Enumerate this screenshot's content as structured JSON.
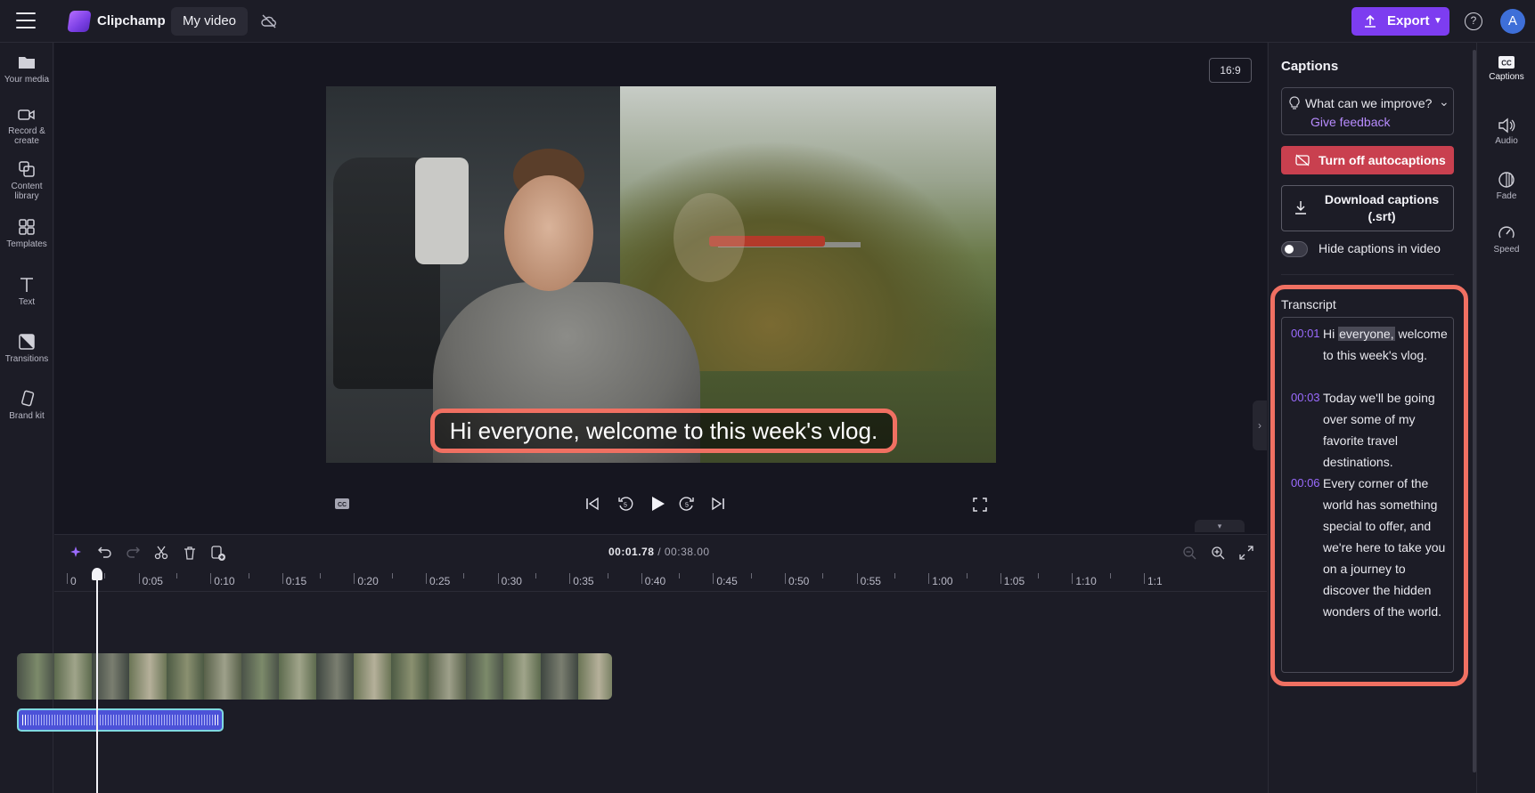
{
  "topbar": {
    "brand": "Clipchamp",
    "project_title": "My video",
    "export_label": "Export",
    "avatar_initial": "A"
  },
  "leftnav": {
    "items": [
      {
        "label": "Your media",
        "icon": "folder-icon"
      },
      {
        "label": "Record & create",
        "icon": "camera-icon"
      },
      {
        "label": "Content library",
        "icon": "library-icon"
      },
      {
        "label": "Templates",
        "icon": "templates-icon"
      },
      {
        "label": "Text",
        "icon": "text-icon"
      },
      {
        "label": "Transitions",
        "icon": "transitions-icon"
      },
      {
        "label": "Brand kit",
        "icon": "brand-kit-icon"
      }
    ]
  },
  "preview": {
    "aspect_ratio": "16:9",
    "caption": "Hi everyone, welcome to this week's vlog."
  },
  "timeline": {
    "current_time": "00:01.78",
    "total_time": "/ 00:38.00",
    "ruler_labels": [
      "0",
      "0:05",
      "0:10",
      "0:15",
      "0:20",
      "0:25",
      "0:30",
      "0:35",
      "0:40",
      "0:45",
      "0:50",
      "0:55",
      "1:00",
      "1:05",
      "1:10",
      "1:1"
    ],
    "playhead_fraction": 0.047
  },
  "captions_panel": {
    "title": "Captions",
    "feedback_question": "What can we improve?",
    "feedback_link": "Give feedback",
    "turn_off_label": "Turn off autocaptions",
    "download_label": "Download captions (.srt)",
    "hide_toggle_label": "Hide captions in video",
    "hide_toggle_on": false,
    "transcript_title": "Transcript",
    "transcript": [
      {
        "time": "00:01",
        "text_before": "Hi ",
        "highlight": "everyone,",
        "text_after": " welcome to this week's vlog."
      },
      {
        "time": "00:03",
        "text_before": "Today we'll be going over some of my favorite travel destinations.",
        "highlight": "",
        "text_after": ""
      },
      {
        "time": "00:06",
        "text_before": "Every corner of the world has something special to offer, and we're here to take you on a journey to discover the hidden wonders of the world.",
        "highlight": "",
        "text_after": ""
      }
    ]
  },
  "right_rail": {
    "items": [
      {
        "label": "Captions",
        "icon": "cc-icon",
        "active": true
      },
      {
        "label": "Audio",
        "icon": "speaker-icon",
        "active": false
      },
      {
        "label": "Fade",
        "icon": "fade-icon",
        "active": false
      },
      {
        "label": "Speed",
        "icon": "speed-icon",
        "active": false
      }
    ]
  },
  "colors": {
    "accent": "#7d3df0",
    "danger": "#c9404f",
    "highlight_outline": "#f07062",
    "timestamp": "#9b6bff",
    "link": "#b88cff"
  }
}
